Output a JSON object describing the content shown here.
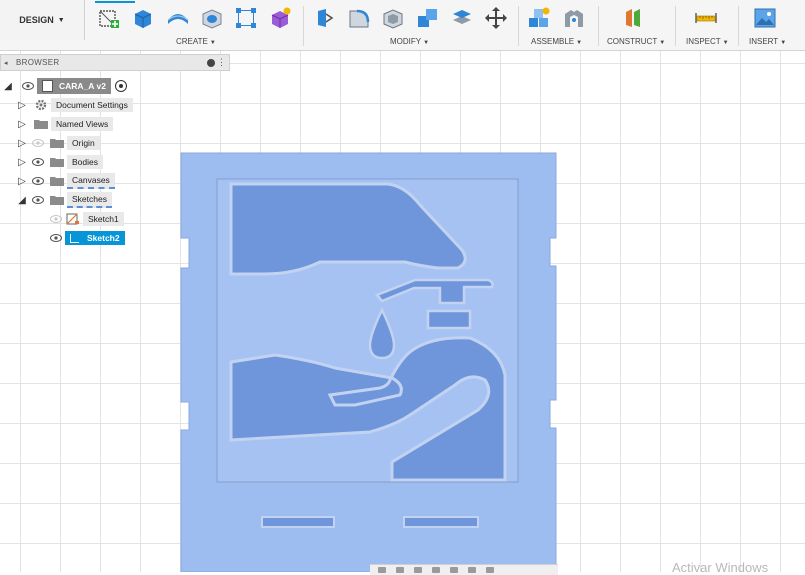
{
  "workspace": {
    "label": "DESIGN"
  },
  "toolbar": {
    "groups": [
      {
        "key": "create",
        "label": "CREATE"
      },
      {
        "key": "modify",
        "label": "MODIFY"
      },
      {
        "key": "assemble",
        "label": "ASSEMBLE"
      },
      {
        "key": "construct",
        "label": "CONSTRUCT"
      },
      {
        "key": "inspect",
        "label": "INSPECT"
      },
      {
        "key": "insert",
        "label": "INSERT"
      }
    ],
    "tools": [
      "create-sketch-icon",
      "extrude-icon",
      "revolve-icon",
      "hole-icon",
      "rectangular-pattern-icon",
      "create-form-icon",
      "press-pull-icon",
      "fillet-icon",
      "shell-icon",
      "combine-icon",
      "offset-face-icon",
      "move-icon",
      "new-component-icon",
      "joint-icon",
      "offset-plane-icon",
      "measure-icon",
      "insert-image-icon"
    ]
  },
  "browser": {
    "title": "BROWSER",
    "root": {
      "label": "CARA_A v2"
    },
    "items": [
      {
        "label": "Document Settings"
      },
      {
        "label": "Named Views"
      },
      {
        "label": "Origin"
      },
      {
        "label": "Bodies"
      },
      {
        "label": "Canvases"
      },
      {
        "label": "Sketches"
      }
    ],
    "sketches": [
      {
        "label": "Sketch1"
      },
      {
        "label": "Sketch2",
        "selected": true
      }
    ]
  },
  "colors": {
    "accent": "#0696d7",
    "sheet_fill": "#9dbcf0",
    "sketch_fill": "#6f95db",
    "outline": "#c2d3f2"
  },
  "watermark": "Activar Windows"
}
